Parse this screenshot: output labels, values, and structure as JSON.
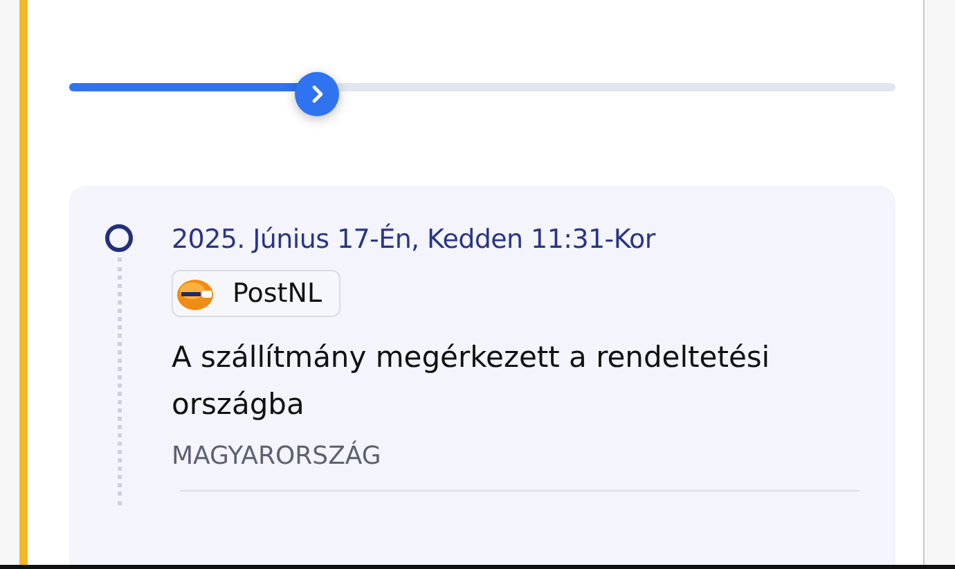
{
  "progress": {
    "level": 0.3
  },
  "events": [
    {
      "datetime": "2025. Június 17-Én, Kedden 11:31-Kor",
      "carrier": "PostNL",
      "description": "A szállítmány megérkezett a rendeltetési országba",
      "location": "MAGYARORSZÁG"
    }
  ]
}
